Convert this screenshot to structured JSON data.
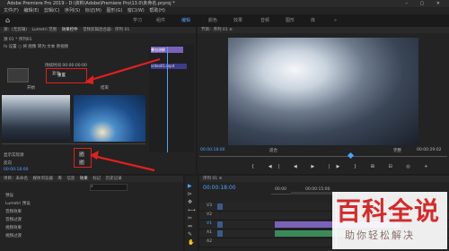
{
  "titlebar": {
    "title": "Adobe Premiere Pro 2019 - D:\\资料\\Adobe\\Premiere Pro\\13.0\\未命名.prproj *",
    "controls": "– ▢ ✕"
  },
  "menu": [
    "文件(F)",
    "编辑(E)",
    "剪辑(C)",
    "序列(S)",
    "标记(M)",
    "图形(G)",
    "窗口(W)",
    "帮助(H)"
  ],
  "workspaces": {
    "home": "⌂",
    "tabs": [
      "学习",
      "组件",
      "编辑",
      "颜色",
      "效果",
      "音频",
      "图形",
      "库"
    ],
    "more": "»"
  },
  "effect_controls": {
    "tabs": [
      "源：(无剪辑)",
      "Lumetri 范围",
      "效果控件",
      "音频剪辑混合器：序列 01"
    ],
    "header": "源 01 * 序列01",
    "fx_label": "fx 设置 ○ 将 图像 转为 文本 原视频",
    "clip_label": "序列 01 * 视频01",
    "field": "持续时间 00:00:00:00",
    "section": "复位",
    "select_button": "重置",
    "caption_left": "开始",
    "caption_right": "结束",
    "checkbox_1_label": "显示实际源",
    "checkbox_2_label": "反向",
    "checkbox_1": "✓",
    "checkbox_2": "✓",
    "timecode": "00:00:18:00"
  },
  "mini_timeline": {
    "clip1": "叠加溶解",
    "clip2": "video01.mp4"
  },
  "program": {
    "title": "节目：序列 01 ≡",
    "timecode_left": "00:00:18:00",
    "fit": "适合",
    "quality": "完整",
    "timecode_right": "00:00:29:02"
  },
  "transport": [
    "{",
    "◀|",
    "◀",
    "▶",
    "|▶",
    "}",
    "⊞",
    "⊟",
    "◎",
    "+"
  ],
  "project": {
    "tabs": [
      "项目：未命名",
      "媒体浏览器",
      "库",
      "信息",
      "效果",
      "标记",
      "历史记录"
    ],
    "search_icon": "search-icon",
    "tree": [
      "预设",
      "Lumetri 预设",
      "音频效果",
      "音频过渡",
      "视频效果",
      "视频过渡"
    ]
  },
  "timeline": {
    "title": "序列 01 ≡",
    "timecode": "00:00:18:00",
    "ruler_left": "00:00",
    "ruler_mid": "00:00:15:00",
    "track_labels": [
      "V3",
      "V2",
      "V1",
      "A1",
      "A2",
      "A3"
    ]
  },
  "tools": [
    "▶",
    "⊳",
    "✥",
    "⟷",
    "✂",
    "⇔",
    "✎",
    "✋",
    "T"
  ],
  "watermark": {
    "line1": "百科全说",
    "line2": "助你轻松解决"
  },
  "colors": {
    "accent": "#4aa3ff",
    "highlight": "#e02020",
    "clip": "#7a62b8"
  }
}
